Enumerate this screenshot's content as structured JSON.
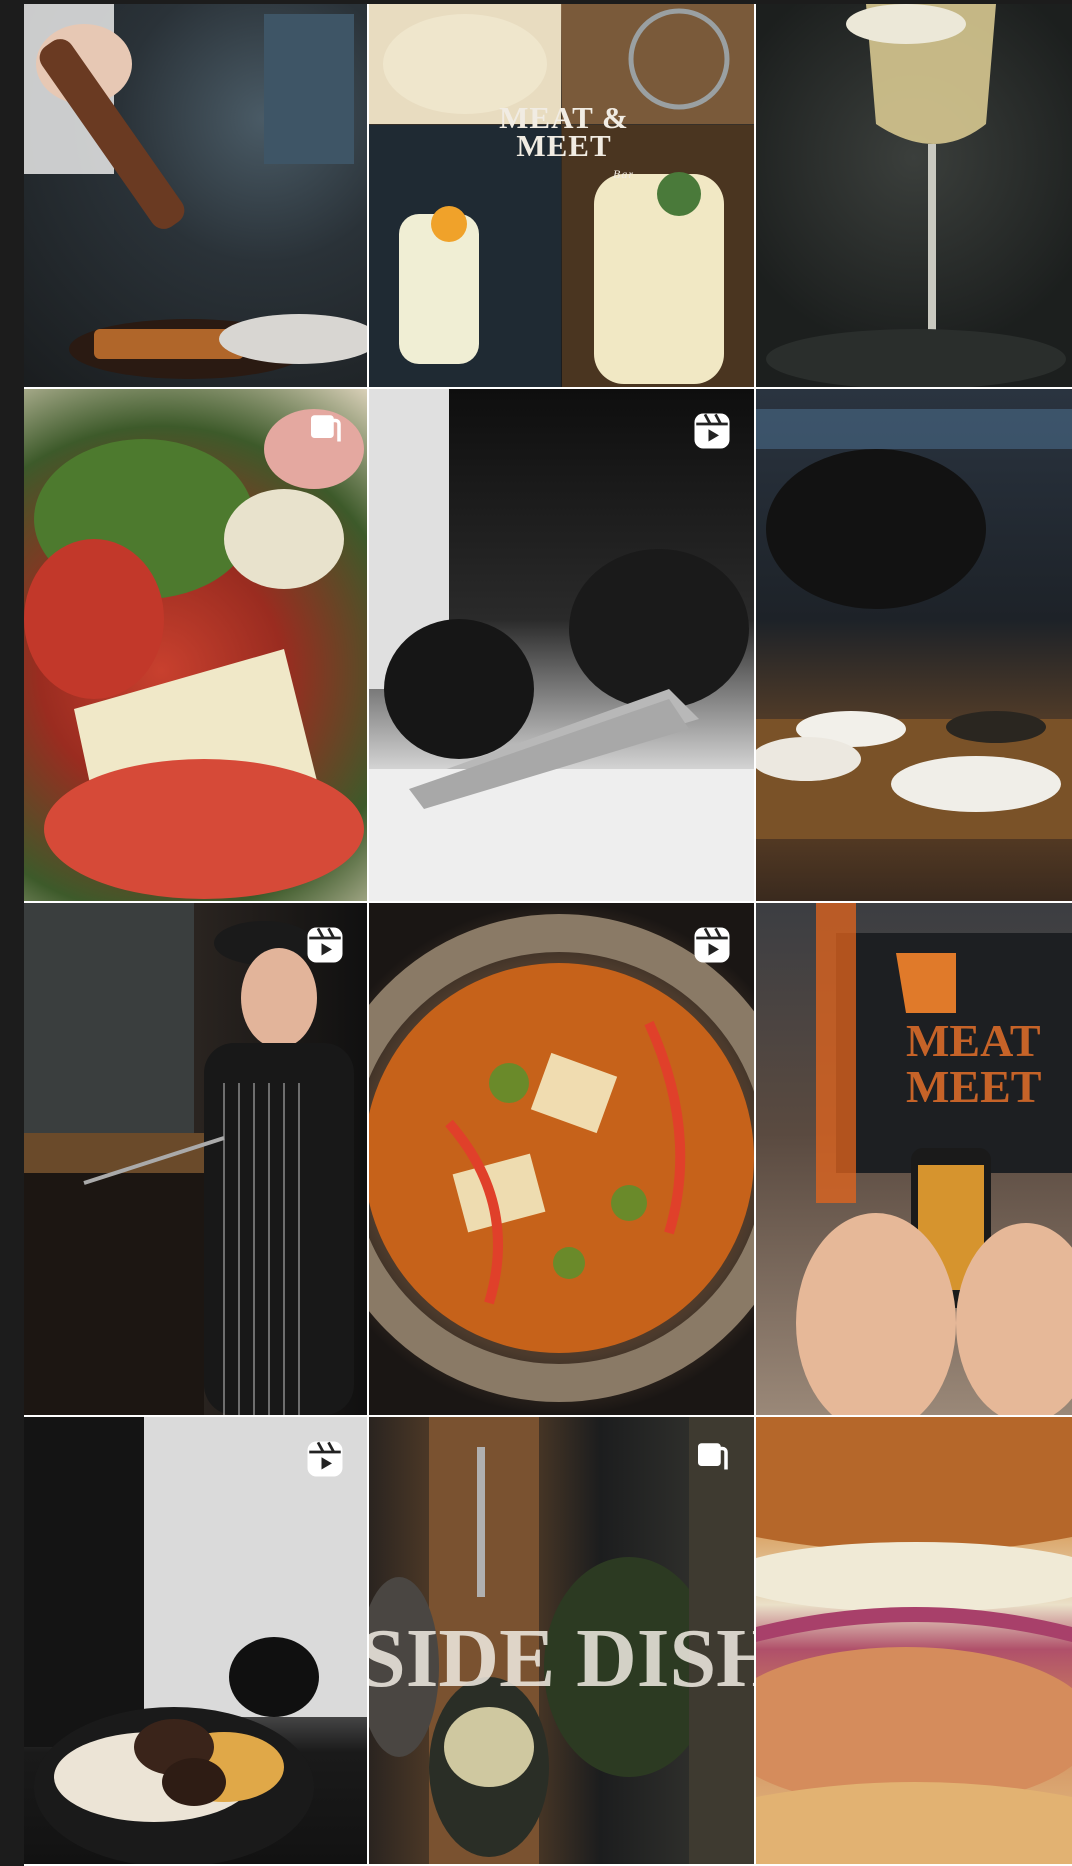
{
  "grid": {
    "tiles": [
      {
        "alt": "Chef seasoning grilled steak with pepper mill",
        "badge": "none"
      },
      {
        "alt": "Cocktails collage with restaurant logo",
        "badge": "none",
        "logo_text": "MEAT & MEET",
        "logo_sub": "Bar"
      },
      {
        "alt": "Glass of sparkling wine",
        "badge": "none"
      },
      {
        "alt": "Salad with arugula, radish and parmesan",
        "badge": "carousel"
      },
      {
        "alt": "Chef slicing with knife in black gloves",
        "badge": "reel"
      },
      {
        "alt": "Dishes on wooden table in evening light",
        "badge": "none"
      },
      {
        "alt": "Chef grilling at the open kitchen",
        "badge": "reel"
      },
      {
        "alt": "Bowl of vegetable noodle soup",
        "badge": "reel"
      },
      {
        "alt": "Phone photographing neon logo wall",
        "badge": "none",
        "neon_text": "MEAT MEET"
      },
      {
        "alt": "Plated steak with puree and sauce",
        "badge": "reel"
      },
      {
        "alt": "Side dishes collage",
        "badge": "carousel",
        "overlay_text": "SIDE DISH"
      },
      {
        "alt": "Pulled meat burger close-up",
        "badge": "none"
      }
    ]
  },
  "colors": {
    "background": "#1c1c1c",
    "gap": "#ffffff",
    "badge": "#ffffff"
  },
  "icons": {
    "reel": "reel-icon",
    "carousel": "carousel-icon"
  }
}
